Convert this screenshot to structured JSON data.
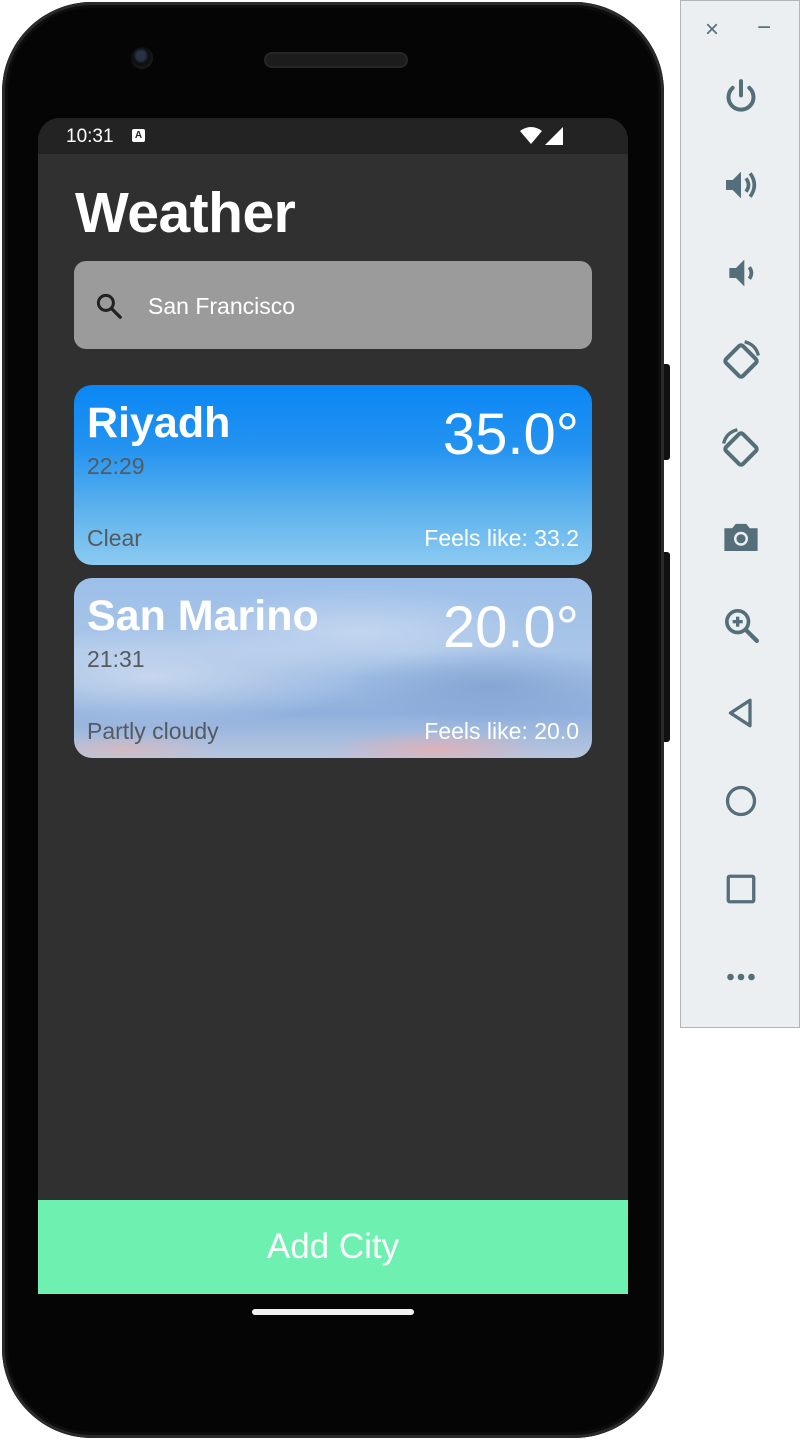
{
  "status_bar": {
    "time": "10:31",
    "notification_letter": "A"
  },
  "app": {
    "title": "Weather",
    "search": {
      "value": "San Francisco",
      "placeholder": ""
    },
    "cities": [
      {
        "name": "Riyadh",
        "local_time": "22:29",
        "temperature": "35.0°",
        "condition": "Clear",
        "feels_like": "Feels like: 33.2"
      },
      {
        "name": "San Marino",
        "local_time": "21:31",
        "temperature": "20.0°",
        "condition": "Partly cloudy",
        "feels_like": "Feels like: 20.0"
      }
    ],
    "add_button_label": "Add City",
    "accent_color": "#6ef0b0",
    "background_color": "#303030",
    "search_bg_color": "#9b9b9b"
  },
  "emulator_toolbar": {
    "close_glyph": "×",
    "minimize_glyph": "−",
    "buttons": [
      "power-icon",
      "volume-up-icon",
      "volume-down-icon",
      "rotate-left-icon",
      "rotate-right-icon",
      "camera-icon",
      "zoom-icon",
      "back-icon",
      "home-icon",
      "overview-icon",
      "more-icon"
    ]
  }
}
